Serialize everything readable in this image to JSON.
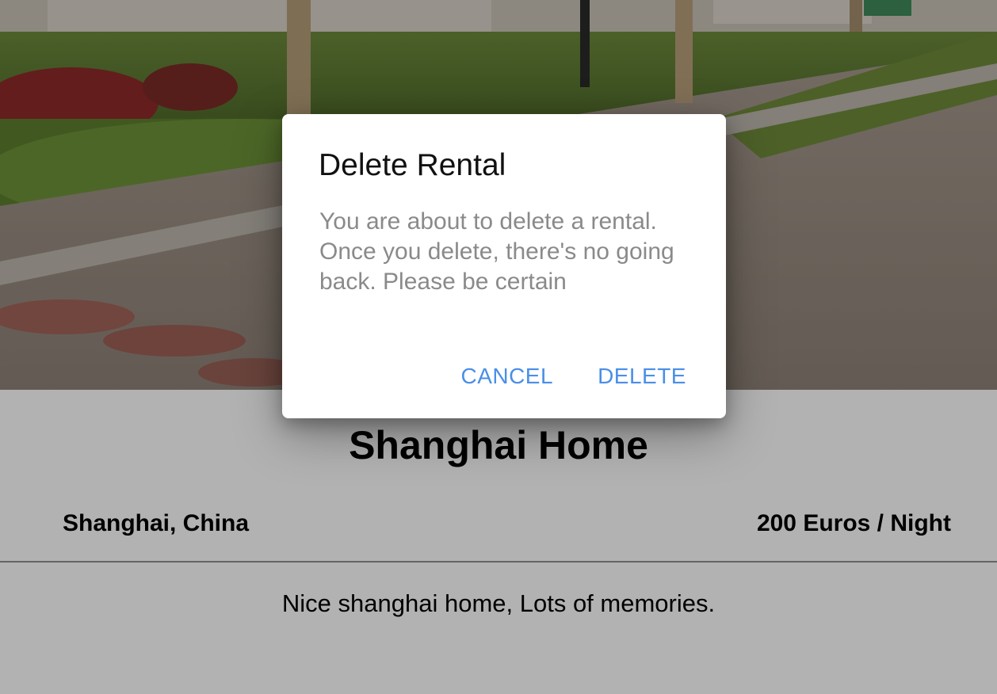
{
  "rental": {
    "title": "Shanghai Home",
    "location": "Shanghai, China",
    "price": "200 Euros / Night",
    "description": "Nice shanghai home, Lots of memories."
  },
  "dialog": {
    "title": "Delete Rental",
    "message": "You are about to delete a rental. Once you delete, there's no going back. Please be certain",
    "cancel_label": "CANCEL",
    "delete_label": "DELETE"
  },
  "colors": {
    "accent": "#4a8fe7",
    "message_text": "#8a8a8a",
    "scrim": "rgba(0,0,0,0.30)"
  }
}
